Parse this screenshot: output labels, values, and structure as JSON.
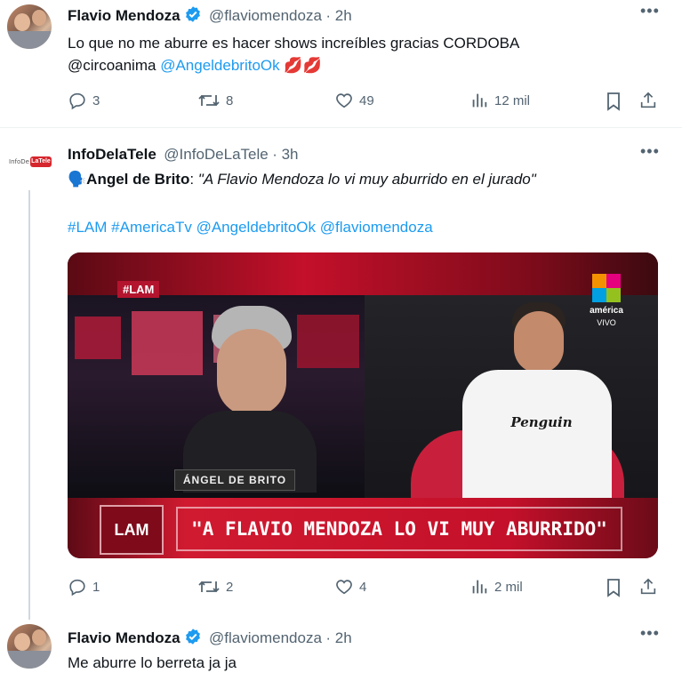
{
  "tweets": [
    {
      "name": "Flavio Mendoza",
      "handle": "@flaviomendoza",
      "time": "· 2h",
      "text_plain": "Lo que no me aburre es hacer shows increíbles gracias CORDOBA",
      "text_handle1": "@circoanima",
      "text_handle2": "@AngeldebritoOk",
      "emoji": "💋💋",
      "replies": "3",
      "retweets": "8",
      "likes": "49",
      "views": "12 mil"
    },
    {
      "name": "InfoDelaTele",
      "handle": "@InfoDeLaTele",
      "time": "· 3h",
      "logo_text": "InfoDeLaTele",
      "speaker_emoji": "🗣️",
      "speaker": "Angel de Brito",
      "quote": "\"A Flavio Mendoza lo vi muy aburrido en el jurado\"",
      "hashtags": [
        "#LAM",
        "#AmericaTv",
        "@AngeldebritoOk",
        "@flaviomendoza"
      ],
      "replies": "1",
      "retweets": "2",
      "likes": "4",
      "views": "2 mil",
      "media": {
        "tag": "#LAM",
        "channel": "américa",
        "channel_sub": "VIVO",
        "name_plate": "ÁNGEL DE BRITO",
        "logo": "LAM",
        "headline": "\"A FLAVIO MENDOZA LO VI MUY ABURRIDO\"",
        "shirt_text": "Penguin"
      }
    },
    {
      "name": "Flavio Mendoza",
      "handle": "@flaviomendoza",
      "time": "· 2h",
      "text": "Me aburre lo berreta ja ja"
    }
  ],
  "colors": {
    "link": "#1d9bf0",
    "verified": "#1d9bf0",
    "muted": "#536471",
    "media_red": "#c4102a"
  },
  "icons": [
    "reply-icon",
    "retweet-icon",
    "like-icon",
    "views-icon",
    "bookmark-icon",
    "share-icon",
    "more-icon",
    "verified-icon"
  ]
}
